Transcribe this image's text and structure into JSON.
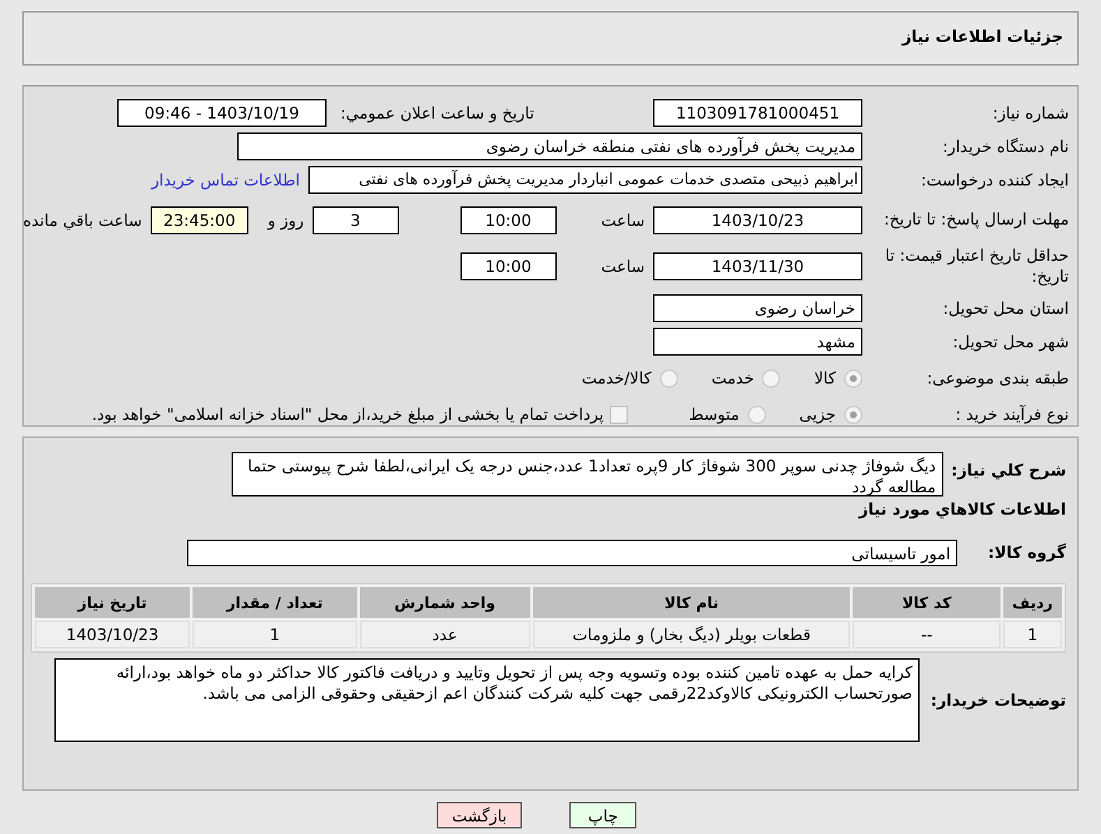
{
  "page_title": "جزئیات اطلاعات نیاز",
  "need_number": {
    "label": "شماره نیاز:",
    "value": "1103091781000451"
  },
  "announcement": {
    "label": "تاریخ و ساعت اعلان عمومي:",
    "value": "1403/10/19 - 09:46"
  },
  "buyer_org": {
    "label": "نام دستگاه خریدار:",
    "value": "مدیریت پخش فرآورده های نفتی منطقه خراسان رضوی"
  },
  "requester": {
    "label": "ایجاد کننده درخواست:",
    "value": "ابراهیم ذبیحی متصدی خدمات عمومی انباردار مدیریت پخش فرآورده های نفتی",
    "link": "اطلاعات تماس خریدار"
  },
  "reply_deadline": {
    "label": "مهلت ارسال پاسخ: تا تاریخ:",
    "date": "1403/10/23",
    "time_label": "ساعت",
    "time": "10:00",
    "days": "3",
    "days_label": "روز و",
    "remaining": "23:45:00",
    "remaining_label": "ساعت باقي مانده"
  },
  "price_validity": {
    "label": "حداقل تاریخ اعتبار قیمت: تا تاریخ:",
    "date": "1403/11/30",
    "time_label": "ساعت",
    "time": "10:00"
  },
  "province": {
    "label": "استان محل تحویل:",
    "value": "خراسان رضوی"
  },
  "city": {
    "label": "شهر محل تحویل:",
    "value": "مشهد"
  },
  "category": {
    "label": "طبقه بندی موضوعی:",
    "options": [
      {
        "label": "کالا",
        "selected": true
      },
      {
        "label": "خدمت",
        "selected": false
      },
      {
        "label": "کالا/خدمت",
        "selected": false
      }
    ]
  },
  "purchase_type": {
    "label": "نوع فرآیند خرید :",
    "options": [
      {
        "label": "جزیی",
        "selected": true
      },
      {
        "label": "متوسط",
        "selected": false
      }
    ],
    "treasury": {
      "label": "پرداخت تمام یا بخشی از مبلغ خرید،از محل \"اسناد خزانه اسلامی\" خواهد بود.",
      "checked": false
    }
  },
  "description": {
    "label": "شرح کلي نياز:",
    "value": "دیگ شوفاژ چدنی سوپر 300 شوفاژ کار 9پره تعداد1 عدد،جنس درجه یک ایرانی،لطفا شرح پیوستی حتما مطالعه گردد"
  },
  "goods_heading": "اطلاعات کالاهاي مورد نياز",
  "goods_group": {
    "label": "گروه کالا:",
    "value": "امور تاسیساتی"
  },
  "table": {
    "columns": [
      "ردیف",
      "کد کالا",
      "نام کالا",
      "واحد شمارش",
      "تعداد / مقدار",
      "تاریخ نیاز"
    ],
    "rows": [
      [
        "1",
        "--",
        "قطعات بویلر (دیگ بخار) و ملزومات",
        "عدد",
        "1",
        "1403/10/23"
      ]
    ]
  },
  "buyer_notes": {
    "label": "توضیحات خریدار:",
    "value": "کرایه حمل به عهده تامین کننده بوده وتسویه وجه پس از تحویل وتایید و دریافت فاکتور کالا حداکثر دو ماه خواهد بود،ارائه صورتحساب الکترونیکی کالاوکد22رقمی جهت کلیه شرکت کنندگان اعم ازحقیقی وحقوقی الزامی می باشد."
  },
  "buttons": [
    {
      "label": "چاپ",
      "kind": "print"
    },
    {
      "label": "بازگشت",
      "kind": "back"
    }
  ]
}
